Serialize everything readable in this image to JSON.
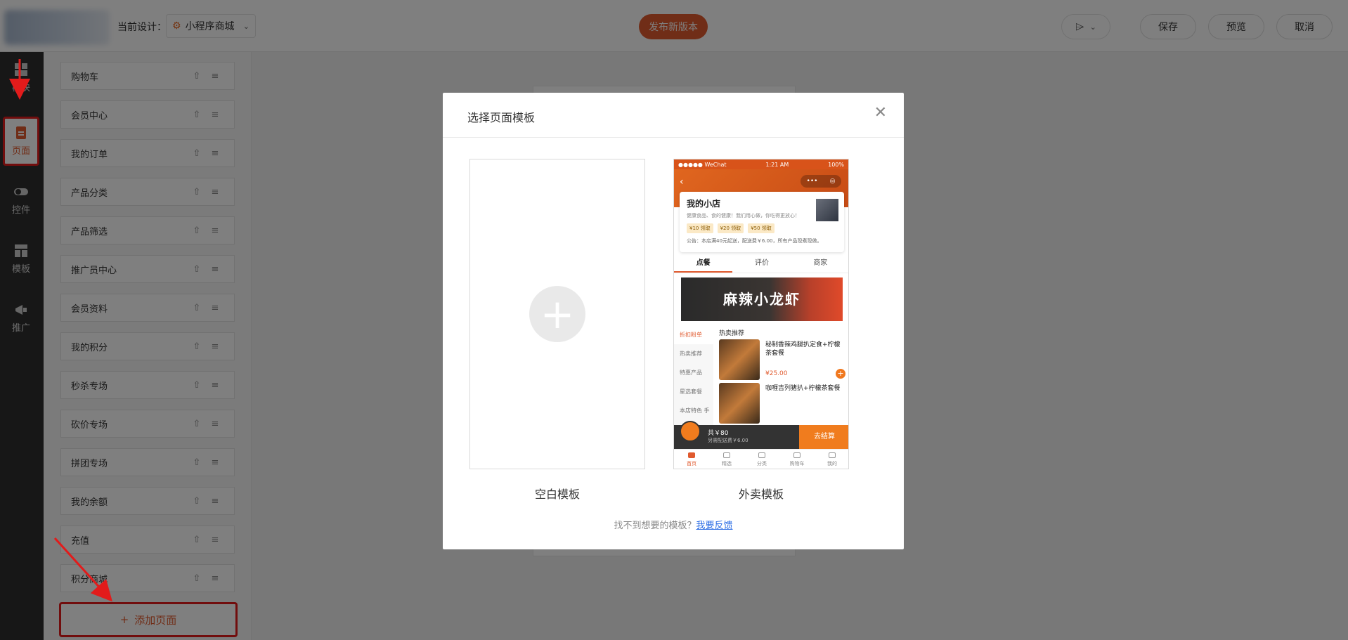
{
  "topbar": {
    "design_label": "当前设计：",
    "design_value": "小程序商城",
    "publish_label": "发布新版本",
    "save_label": "保存",
    "preview_label": "预览",
    "cancel_label": "取消"
  },
  "leftnav": {
    "items": [
      {
        "label": "模块",
        "icon": "module-icon"
      },
      {
        "label": "页面",
        "icon": "page-icon",
        "active": true
      },
      {
        "label": "控件",
        "icon": "toggle-icon"
      },
      {
        "label": "模板",
        "icon": "template-icon"
      },
      {
        "label": "推广",
        "icon": "megaphone-icon"
      }
    ]
  },
  "pages": [
    "购物车",
    "会员中心",
    "我的订单",
    "产品分类",
    "产品筛选",
    "推广员中心",
    "会员资料",
    "我的积分",
    "秒杀专场",
    "砍价专场",
    "拼团专场",
    "我的余额",
    "充值",
    "积分商城"
  ],
  "add_page_label": "添加页面",
  "modal": {
    "title": "选择页面模板",
    "blank_caption": "空白模板",
    "takeaway_caption": "外卖模板",
    "feedback_text": "找不到想要的模板？",
    "feedback_link": "我要反馈"
  },
  "phone": {
    "status_left": "●●●●● WeChat",
    "status_time": "1:21 AM",
    "status_right": "100%",
    "shop_name": "我的小店",
    "shop_desc": "健康食品、食的健康！我们用心做，你吃得更放心！",
    "coupons": [
      "¥10 领取",
      "¥20 领取",
      "¥50 领取"
    ],
    "notice": "公告：本店满40元起送，配送费￥6.00，所有产品现煮现做。",
    "tabs": [
      "点餐",
      "评价",
      "商家"
    ],
    "banner": "麻辣小龙虾",
    "side_menu": [
      "折扣粉单",
      "热卖推荐",
      "特惠产品",
      "星选套餐",
      "本店特色 手抓饼"
    ],
    "section_title": "热卖推荐",
    "products": [
      {
        "name": "秘制香辣鸡腿扒定食+柠檬茶套餐",
        "price": "¥25.00"
      },
      {
        "name": "咖喱吉列猪扒+柠檬茶套餐",
        "price": ""
      }
    ],
    "cart_total": "共￥80",
    "cart_fee": "另需配送费￥6.00",
    "checkout": "去结算",
    "tabbar": [
      "首页",
      "精选",
      "分类",
      "购物车",
      "我的"
    ]
  },
  "colors": {
    "accent": "#e05a2e",
    "annotation_red": "#e21b1b"
  }
}
